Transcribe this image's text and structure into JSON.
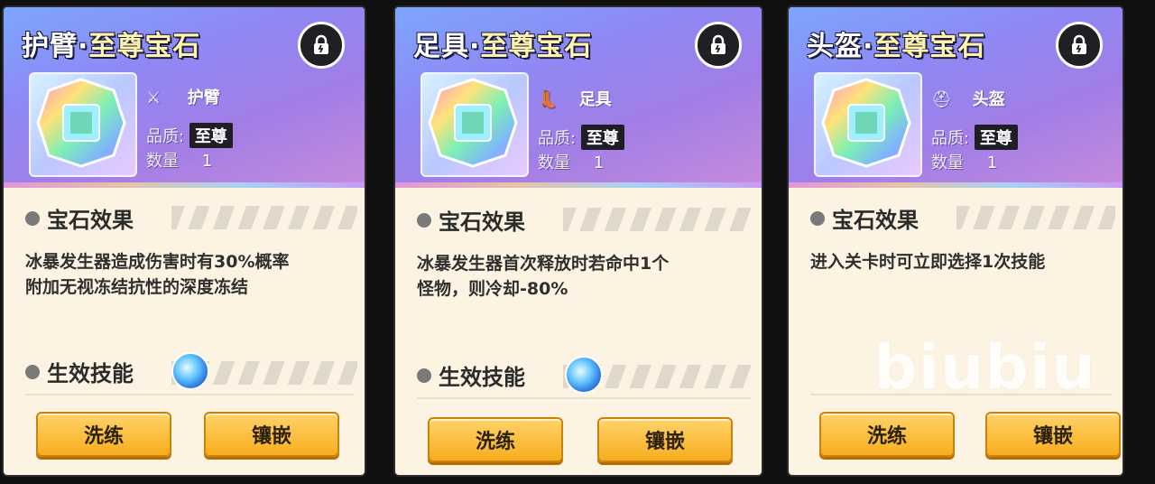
{
  "cards": [
    {
      "title_part": "护臂",
      "title_sep": "·",
      "title_accent": "至尊宝石",
      "slot_name": "护臂",
      "quality_label": "品质:",
      "quality_value": "至尊",
      "count_label": "数量",
      "count_value": "1",
      "effect_title": "宝石效果",
      "effect_desc_line1": "冰暴发生器造成伤害时有30%概率",
      "effect_desc_line2": "附加无视冻结抗性的深度冻结",
      "skill_title": "生效技能",
      "btn_refine": "洗练",
      "btn_inlay": "镶嵌",
      "slot_icon": "arm-guard-icon"
    },
    {
      "title_part": "足具",
      "title_sep": "·",
      "title_accent": "至尊宝石",
      "slot_name": "足具",
      "quality_label": "品质:",
      "quality_value": "至尊",
      "count_label": "数量",
      "count_value": "1",
      "effect_title": "宝石效果",
      "effect_desc_line1": "冰暴发生器首次释放时若命中1个",
      "effect_desc_line2": "怪物，则冷却-80%",
      "skill_title": "生效技能",
      "btn_refine": "洗练",
      "btn_inlay": "镶嵌",
      "slot_icon": "boot-icon"
    },
    {
      "title_part": "头盔",
      "title_sep": "·",
      "title_accent": "至尊宝石",
      "slot_name": "头盔",
      "quality_label": "品质:",
      "quality_value": "至尊",
      "count_label": "数量",
      "count_value": "1",
      "effect_title": "宝石效果",
      "effect_desc_line1": "进入关卡时可立即选择1次技能",
      "btn_refine": "洗练",
      "btn_inlay": "镶嵌",
      "slot_icon": "helmet-icon"
    }
  ],
  "watermark": "biubiu",
  "colors": {
    "header_gradient_start": "#7ca6ff",
    "header_gradient_end": "#c68bdc",
    "button_yellow": "#f7ad1d",
    "card_bg": "#fdf3e2"
  }
}
